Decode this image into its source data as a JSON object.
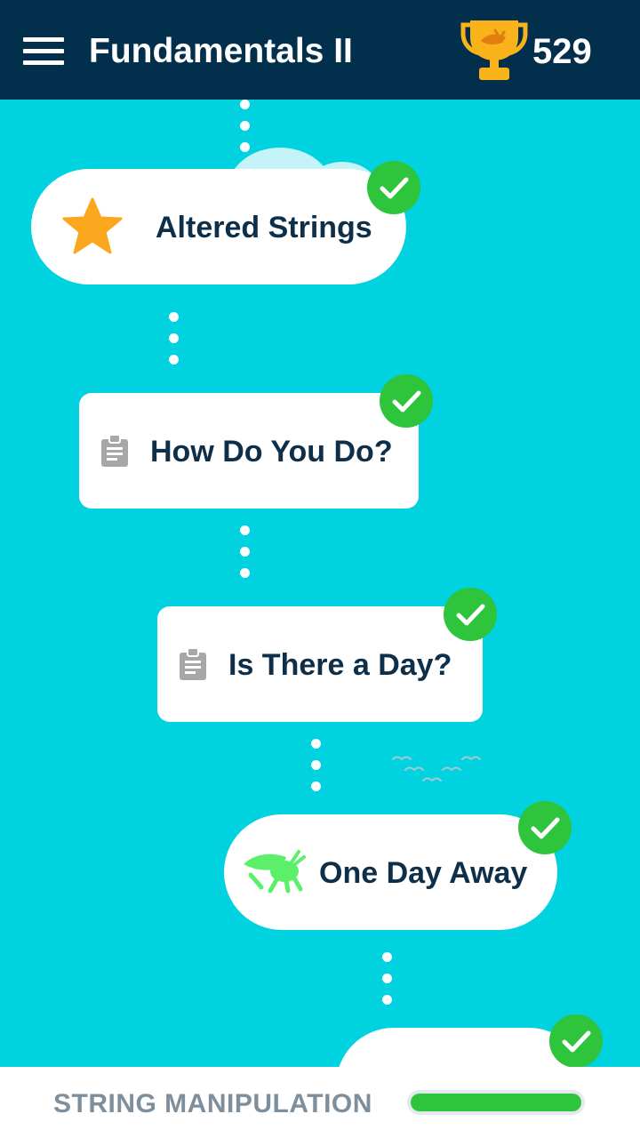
{
  "header": {
    "title": "Fundamentals II",
    "menu_icon": "hamburger-menu-icon",
    "trophy_icon": "trophy-icon",
    "score": "529",
    "colors": {
      "background": "#022f4c",
      "trophy": "#f9b21a"
    }
  },
  "map": {
    "background_color": "#00d2e0",
    "nodes": [
      {
        "label": "Altered Strings",
        "icon": "star-icon",
        "completed": true
      },
      {
        "label": "How Do You Do?",
        "icon": "clipboard-icon",
        "completed": true
      },
      {
        "label": "Is There a Day?",
        "icon": "clipboard-icon",
        "completed": true
      },
      {
        "label": "One Day Away",
        "icon": "grasshopper-icon",
        "completed": true
      },
      {
        "label": "",
        "icon": "grasshopper-icon",
        "completed": true
      }
    ],
    "check_color": "#2ec43c"
  },
  "footer": {
    "section_label": "STRING MANIPULATION",
    "progress": 1.0,
    "progress_color": "#2ec43c"
  }
}
